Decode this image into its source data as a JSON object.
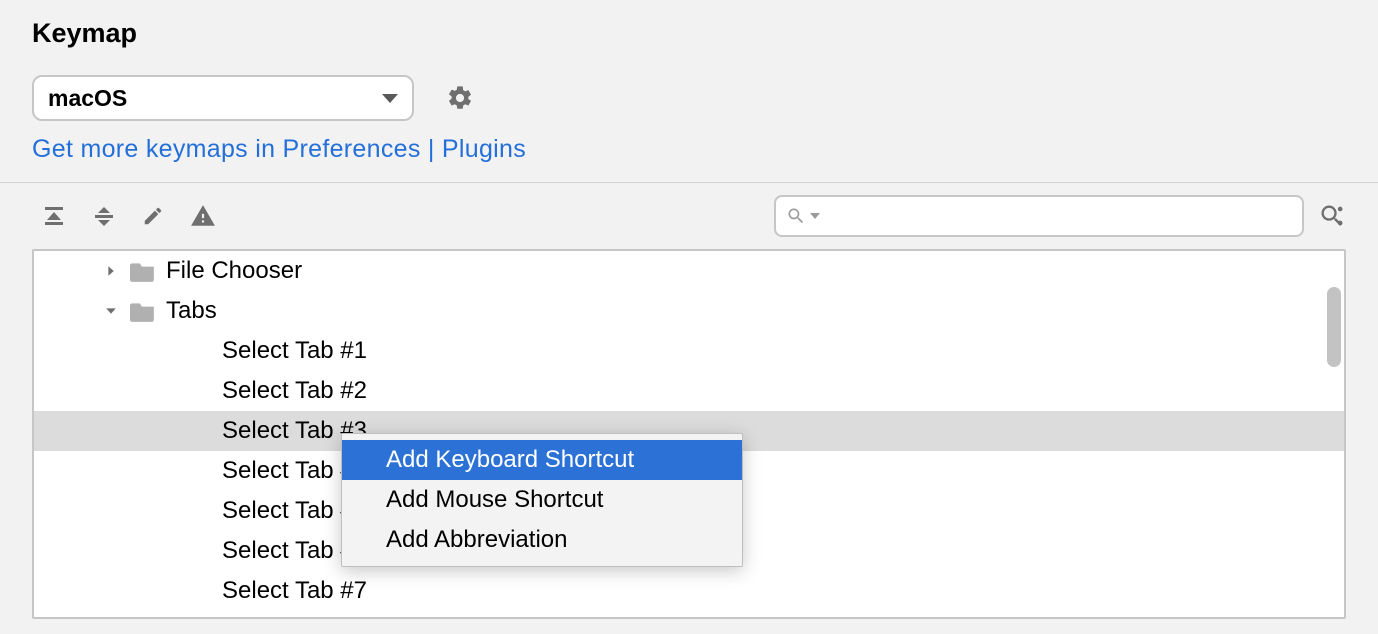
{
  "title": "Keymap",
  "selector": {
    "value": "macOS"
  },
  "link": {
    "text": "Get more keymaps in Preferences | Plugins"
  },
  "search": {
    "placeholder": ""
  },
  "tree": {
    "items": [
      {
        "label": "File Chooser",
        "type": "folder",
        "expanded": false
      },
      {
        "label": "Tabs",
        "type": "folder",
        "expanded": true,
        "children_prefix": "Select Tab #"
      }
    ],
    "leaves": [
      "Select Tab #1",
      "Select Tab #2",
      "Select Tab #3",
      "Select Tab #4",
      "Select Tab #5",
      "Select Tab #6",
      "Select Tab #7"
    ],
    "selected_index": 2
  },
  "context_menu": {
    "items": [
      "Add Keyboard Shortcut",
      "Add Mouse Shortcut",
      "Add Abbreviation"
    ],
    "highlight_index": 0
  }
}
